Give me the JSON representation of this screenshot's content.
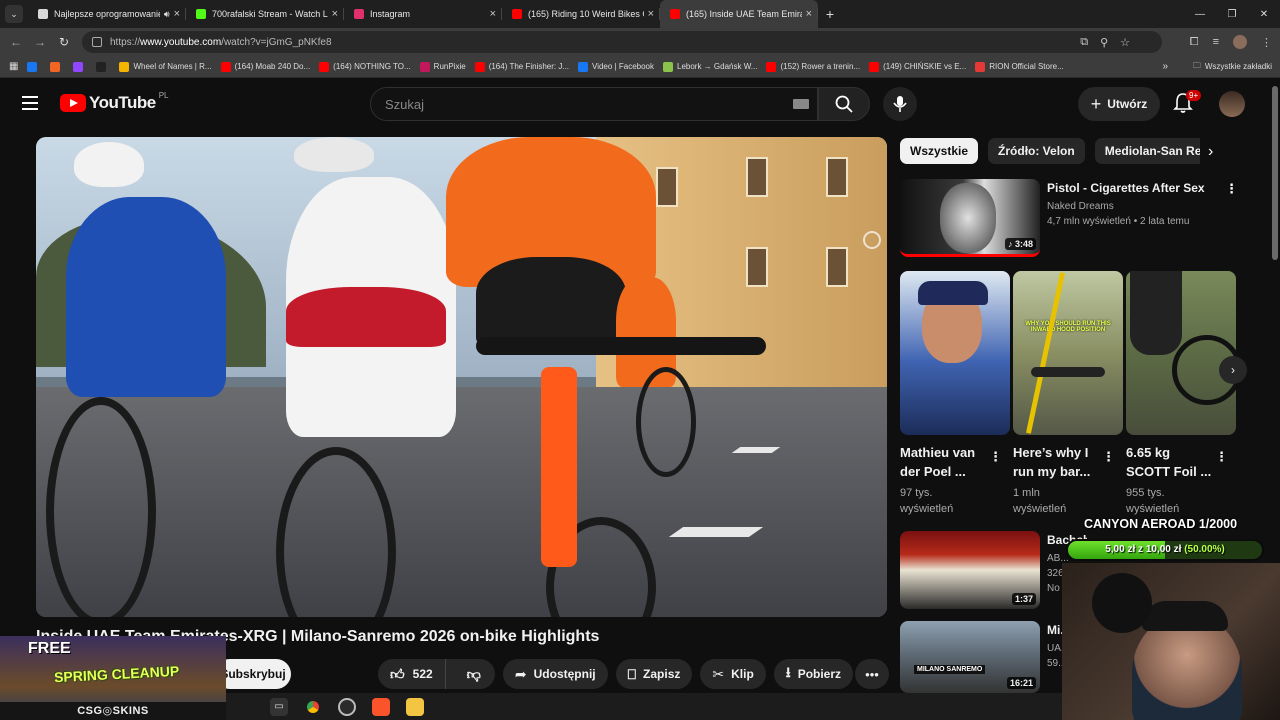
{
  "browser": {
    "tabs": [
      {
        "title": "Najlepsze oprogramowanie",
        "color": "#d9d9d9",
        "audio": true,
        "active": false
      },
      {
        "title": "700rafalski Stream - Watch Live",
        "color": "#53fc18",
        "active": false
      },
      {
        "title": "Instagram",
        "color": "#e1306c",
        "active": false
      },
      {
        "title": "(165) Riding 10 Weird Bikes On",
        "color": "#ff0000",
        "active": false
      },
      {
        "title": "(165) Inside UAE Team Emirates",
        "color": "#ff0000",
        "active": true
      }
    ],
    "url_prefix": "https://",
    "url_host": "www.youtube.com",
    "url_path": "/watch?v=jGmG_pNKfe8",
    "bookmarks": [
      {
        "label": "",
        "color": "#1877f2"
      },
      {
        "label": "",
        "color": "#f26522"
      },
      {
        "label": "",
        "color": "#9146ff"
      },
      {
        "label": "",
        "color": "#222222"
      },
      {
        "label": "Wheel of Names | R...",
        "color": "#f4b400"
      },
      {
        "label": "(164) Moab 240 Do...",
        "color": "#ff0000"
      },
      {
        "label": "(164) NOTHING TO...",
        "color": "#ff0000"
      },
      {
        "label": "RunPixie",
        "color": "#c2185b"
      },
      {
        "label": "(164) The Finisher: J...",
        "color": "#ff0000"
      },
      {
        "label": "Video | Facebook",
        "color": "#1877f2"
      },
      {
        "label": "Lebork → Gdańsk W...",
        "color": "#8bc34a"
      },
      {
        "label": "(152) Rower a trenin...",
        "color": "#ff0000"
      },
      {
        "label": "(149) CHIŃSKIE vs E...",
        "color": "#ff0000"
      },
      {
        "label": "RION Official Store...",
        "color": "#e53935"
      }
    ],
    "all_bookmarks": "Wszystkie zakładki",
    "more": "»"
  },
  "youtube": {
    "logo_text": "YouTube",
    "country": "PL",
    "search_placeholder": "Szukaj",
    "create_label": "Utwórz",
    "notifications": "9+"
  },
  "video": {
    "title": "Inside UAE Team Emirates-XRG | Milano-Sanremo 2026 on-bike Highlights",
    "subscribe": "Subskrybuj",
    "likes": "522",
    "share": "Udostępnij",
    "save": "Zapisz",
    "clip": "Klip",
    "download": "Pobierz"
  },
  "chips": [
    "Wszystkie",
    "Źródło: Velon",
    "Mediolan-San Remo"
  ],
  "recommend_top": {
    "title": "Pistol - Cigarettes After Sex",
    "channel": "Naked Dreams",
    "meta": "4,7 mln wyświetleń • 2 lata temu",
    "duration": "3:48"
  },
  "shorts": [
    {
      "title": "Mathieu van der Poel ...",
      "views": "97 tys.",
      "views_label": "wyświetleń",
      "caption": ""
    },
    {
      "title": "Here’s why I run my bar...",
      "views": "1 mln",
      "views_label": "wyświetleń",
      "caption": "WHY YOU SHOULD RUN THIS INWARD HOOD POSITION"
    },
    {
      "title": "6.65 kg SCOTT Foil ...",
      "views": "955 tys.",
      "views_label": "wyświetleń",
      "caption": ""
    }
  ],
  "recommend_more": [
    {
      "title": "Bachchu Kadu | ...",
      "channel": "AB...",
      "meta": "326...",
      "badge": "No",
      "duration": "1:37"
    },
    {
      "title": "Mi... the...",
      "channel": "UA...",
      "meta": "59...",
      "badge": "",
      "duration": "16:21",
      "thumb_label": "MILANO SANREMO"
    }
  ],
  "overlay": {
    "goal_title": "CANYON AEROAD 1/2000",
    "progress_current": "5,00 zł",
    "progress_sep": " z ",
    "progress_target": "10,00 zł",
    "progress_pct": "(50.00%)",
    "progress_fraction": 0.5
  },
  "promo": {
    "free": "FREE",
    "headline": "SPRING CLEANUP",
    "brand": "CSG◎SKINS"
  },
  "colors": {
    "yt_red": "#ff0000",
    "bg": "#0f0f0f",
    "chip_bg": "#272727",
    "overlay_green": "#53c21a"
  }
}
